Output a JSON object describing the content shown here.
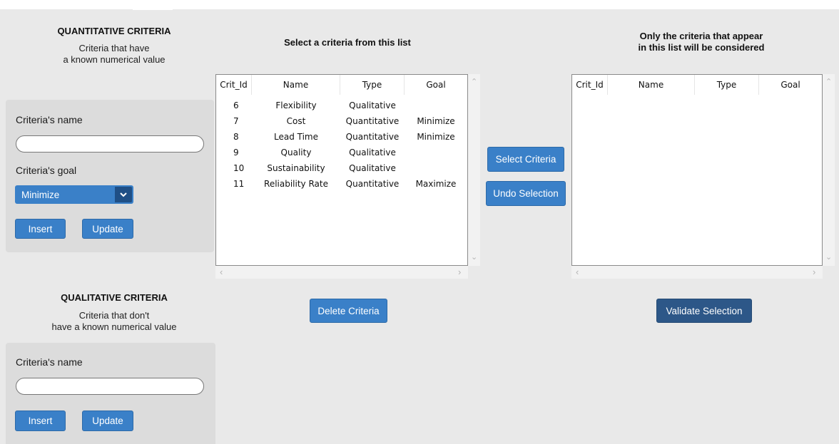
{
  "quantitative": {
    "title": "QUANTITATIVE CRITERIA",
    "subtitle_line1": "Criteria that have",
    "subtitle_line2": "a known numerical value",
    "name_label": "Criteria's name",
    "name_value": "",
    "goal_label": "Criteria's goal",
    "goal_selected": "Minimize",
    "insert_label": "Insert",
    "update_label": "Update"
  },
  "qualitative": {
    "title": "QUALITATIVE CRITERIA",
    "subtitle_line1": "Criteria that don't",
    "subtitle_line2": "have a known numerical value",
    "name_label": "Criteria's name",
    "name_value": "",
    "insert_label": "Insert",
    "update_label": "Update"
  },
  "left_list": {
    "heading": "Select a criteria from this list",
    "columns": [
      "Crit_Id",
      "Name",
      "Type",
      "Goal"
    ],
    "rows": [
      [
        "6",
        "Flexibility",
        "Qualitative",
        ""
      ],
      [
        "7",
        "Cost",
        "Quantitative",
        "Minimize"
      ],
      [
        "8",
        "Lead Time",
        "Quantitative",
        "Minimize"
      ],
      [
        "9",
        "Quality",
        "Qualitative",
        ""
      ],
      [
        "10",
        "Sustainability",
        "Qualitative",
        ""
      ],
      [
        "11",
        "Reliability Rate",
        "Quantitative",
        "Maximize"
      ]
    ],
    "delete_label": "Delete Criteria"
  },
  "middle": {
    "select_label": "Select Criteria",
    "undo_label": "Undo Selection"
  },
  "right_list": {
    "heading_line1": "Only the criteria that appear",
    "heading_line2": "in this list will be considered",
    "columns": [
      "Crit_Id",
      "Name",
      "Type",
      "Goal"
    ],
    "rows": [],
    "validate_label": "Validate Selection"
  },
  "colors": {
    "button": "#3a80c8",
    "button_dark": "#2d5788",
    "background": "#e9e9e9",
    "panel": "#dcdcdc"
  }
}
